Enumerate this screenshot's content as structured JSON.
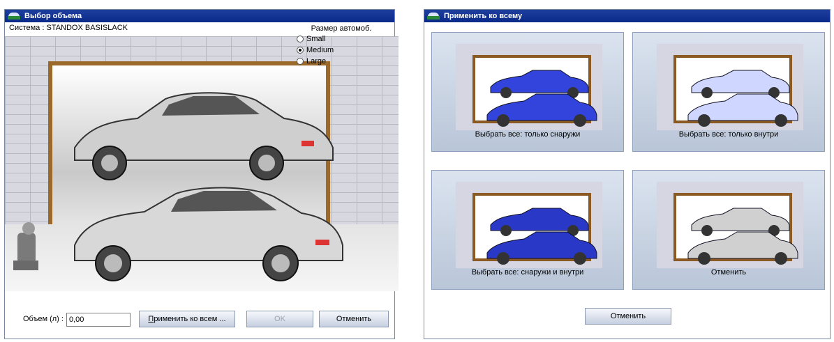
{
  "left": {
    "title": "Выбор объема",
    "system": "Система : STANDOX BASISLACK",
    "size_header": "Размер автомоб.",
    "sizes": [
      {
        "label": "Small",
        "selected": false
      },
      {
        "label": "Medium",
        "selected": true
      },
      {
        "label": "Large",
        "selected": false
      }
    ],
    "volume_label": "Объем (л) :",
    "volume_value": "0,00",
    "apply_all_prefix": "П",
    "apply_all_rest": "рименить ко всем ...",
    "ok_label": "OK",
    "cancel_label": "Отменить"
  },
  "right": {
    "title": "Применить ко всему",
    "tiles": [
      {
        "caption": "Выбрать все: только снаружи",
        "style": "outside"
      },
      {
        "caption": "Выбрать все: только внутри",
        "style": "inside"
      },
      {
        "caption": "Выбрать все: снаружи и внутри",
        "style": "both"
      },
      {
        "caption": "Отменить",
        "style": "none"
      }
    ],
    "cancel_label": "Отменить"
  },
  "colors": {
    "titlebar": "#0a2a8a",
    "car_blue": "#3344dd",
    "frame_wood": "#9b6a2a"
  }
}
